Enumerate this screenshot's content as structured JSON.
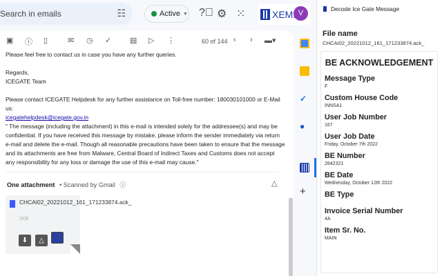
{
  "header": {
    "search_placeholder": "Search in emails",
    "status": "Active",
    "brand": "XEMI",
    "avatar": "V"
  },
  "toolbar": {
    "count": "60 of 144"
  },
  "email": {
    "lines": [
      "Please feel free to contact us in case you have any further queries.",
      "Regards,",
      "ICEGATE Team",
      "Please contact ICEGATE Helpdesk for any further assistance on Toll-free number: 180030101000 or E-Mail us:"
    ],
    "link": "icegatehelpdesk@icegate.gov.in",
    "disclaimer": "\" The message (including the attachment) in this e-mail is intended solely for the addressee(s) and may be confidential. If you have received this message by mistake, please inform the sender immediately via return e-mail and delete the e-mail. Though all reasonable precautions have been taken to ensure that the message and its attachments are free from Malware, Central Board of Indirect Taxes and Customs does not accept any responsibility for any loss or damage the use of this e-mail may cause.\""
  },
  "attachments": {
    "heading": "One attachment",
    "scanned": "• Scanned by Gmail",
    "file": {
      "name": "CHCAI02_20221012_161_171233874.ack_",
      "size": "1KB"
    }
  },
  "panel": {
    "title": "Decode Ice Gate Message",
    "file_label": "File name",
    "file_value": "CHCAI02_20221012_161_171233874.ack_",
    "heading": "BE ACKNOWLEDGEMENT",
    "fields": [
      {
        "label": "Message Type",
        "value": "F"
      },
      {
        "label": "Custom House Code",
        "value": "INNSA1"
      },
      {
        "label": "User Job Number",
        "value": "167"
      },
      {
        "label": "User Job Date",
        "value": "Friday, October 7th 2022"
      },
      {
        "label": "BE Number",
        "value": "2842321"
      },
      {
        "label": "BE Date",
        "value": "Wednesday, October 12th 2022"
      },
      {
        "label": "BE Type",
        "value": ""
      },
      {
        "label": "Invoice Serial Number",
        "value": "4A"
      },
      {
        "label": "Item Sr. No.",
        "value": "MAIN"
      }
    ]
  }
}
